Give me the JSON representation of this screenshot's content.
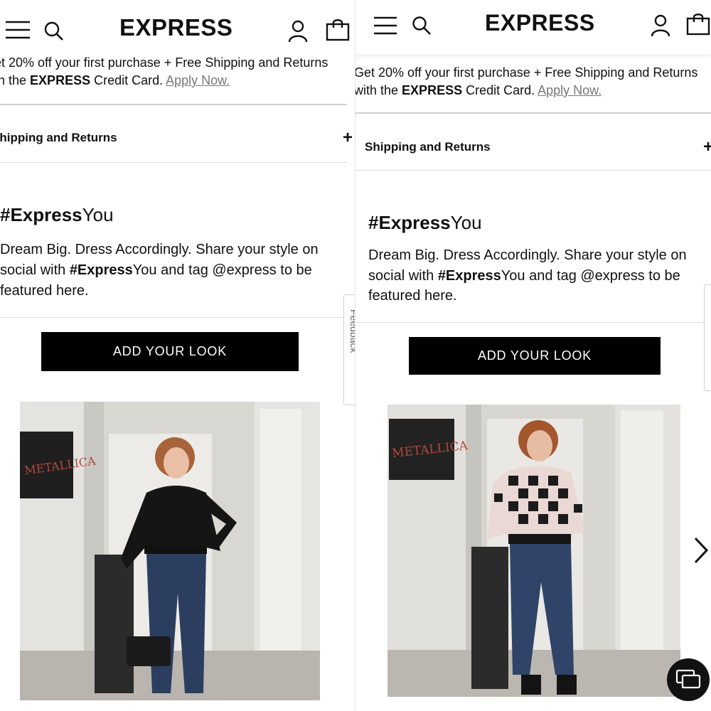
{
  "brand": "EXPRESS",
  "promo": {
    "left_line1": "et 20% off your first purchase + Free Shipping and Returns",
    "left_line2_pre": "th the ",
    "right_line1": "Get 20% off your first purchase + Free Shipping and Returns",
    "right_line2_pre": "with the ",
    "brand_bold": "EXPRESS",
    "line2_post": " Credit Card. ",
    "apply_link": "Apply Now."
  },
  "accordion": {
    "left_label": "Shipping and Returns",
    "right_label": "Shipping and Returns",
    "toggle": "+"
  },
  "ugc": {
    "hash_bold": "#Express",
    "hash_rest": "You",
    "desc_line1": "Dream Big. Dress Accordingly. Share your style on",
    "desc_line2_pre": "social with ",
    "desc_line2_bold": "#Express",
    "desc_line2_post": "You and tag @express to be",
    "desc_line3": "featured here.",
    "button": "ADD YOUR LOOK"
  },
  "photos": {
    "poster_text": "METALLICA"
  },
  "feedback_tab": "Feedback",
  "icons": [
    "menu-icon",
    "search-icon",
    "account-icon",
    "bag-icon",
    "chevron-right-icon",
    "chat-icon"
  ],
  "colors": {
    "button_bg": "#000000",
    "link_gray": "#777777"
  }
}
